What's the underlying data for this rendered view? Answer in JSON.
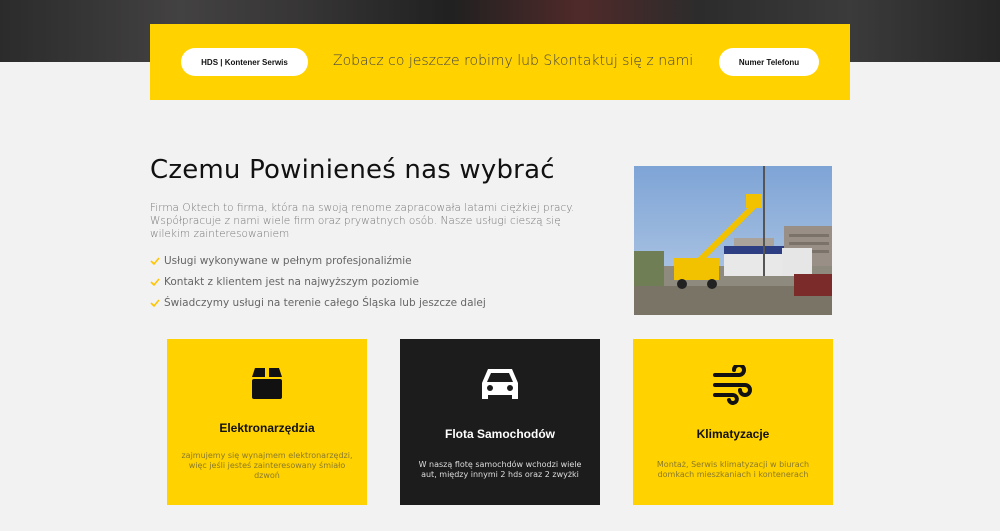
{
  "cta": {
    "left_button": "HDS | Kontener Serwis",
    "text": "Zobacz co jeszcze robimy lub Skontaktuj się z nami",
    "right_button": "Numer Telefonu"
  },
  "why": {
    "title": "Czemu Powinieneś nas wybrać",
    "description": "Firma Oktech to firma, która na swoją renome zapracowała latami ciężkiej pracy. Współpracuje z nami wiele firm oraz prywatnych osób. Nasze usługi cieszą się wilekim zainteresowaniem",
    "items": [
      "Usługi wykonywane w pełnym profesjonaliźmie",
      "Kontakt z klientem jest na najwyższym poziomie",
      "Świadczymy usługi na terenie całego Śląska lub jeszcze dalej"
    ]
  },
  "cards": [
    {
      "title": "Elektronarzędzia",
      "description": "zajmujemy się wynajmem elektronarzędzi, więc jeśli jesteś zainteresowany śmiało dzwoń",
      "icon": "box-icon"
    },
    {
      "title": "Flota Samochodów",
      "description": "W naszą flotę samochdów wchodzi wiele aut, między innymi 2 hds oraz 2 zwyżki",
      "icon": "car-icon"
    },
    {
      "title": "Klimatyzacje",
      "description": "Montaż, Serwis klimatyzacji w biurach domkach mieszkaniach i kontenerach",
      "icon": "wind-icon"
    }
  ],
  "colors": {
    "accent": "#ffd200",
    "dark": "#1d1c1c",
    "background": "#f2f2f2"
  }
}
